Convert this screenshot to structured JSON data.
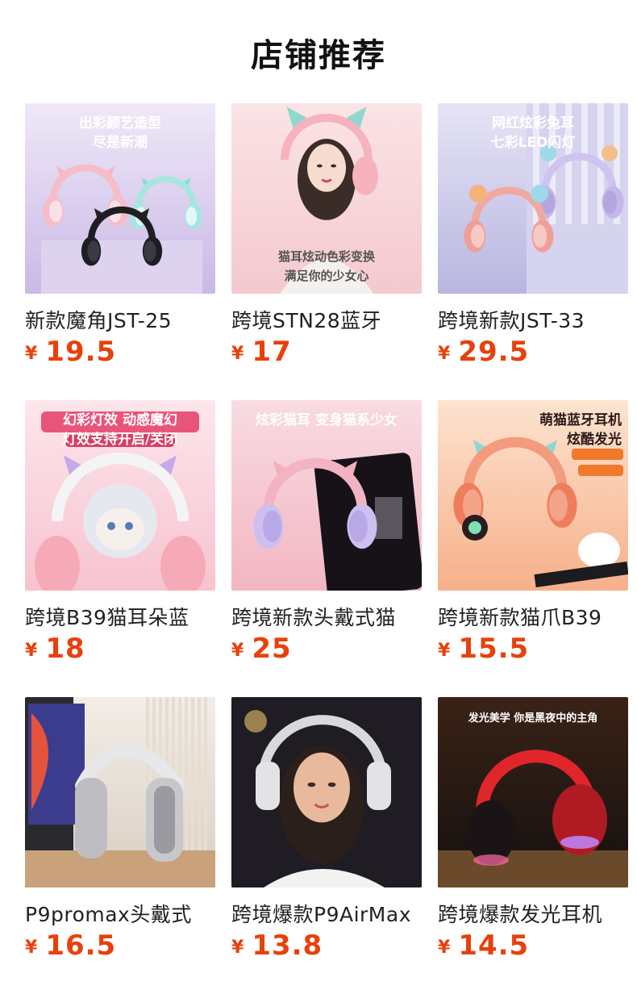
{
  "section_title": "店铺推荐",
  "currency": "¥",
  "products": [
    {
      "name": "新款魔角JST-25",
      "price": "19.5",
      "image": {
        "icon": "cat-ear-headphones-group",
        "lines": [
          "出彩颜艺造型",
          "尽是新潮"
        ],
        "bg1": "#c9b9e6",
        "bg2": "#efe8f8",
        "accent": "#f2a6b4"
      }
    },
    {
      "name": "跨境STN28蓝牙",
      "price": "17",
      "image": {
        "icon": "woman-wearing-headphones",
        "lines": [
          "猫耳炫动色彩变换",
          "满足你的少女心"
        ],
        "bg1": "#f4c9cf",
        "bg2": "#fbe3e6",
        "accent": "#f6b2bd"
      }
    },
    {
      "name": "跨境新款JST-33",
      "price": "29.5",
      "image": {
        "icon": "bear-ear-headphones",
        "lines": [
          "网红炫彩兔耳",
          "七彩LED闪灯"
        ],
        "bg1": "#b8b6e0",
        "bg2": "#e6e4f5",
        "accent": "#f0a7a0"
      }
    },
    {
      "name": "跨境B39猫耳朵蓝",
      "price": "18",
      "image": {
        "icon": "kitten-cat-ear-headphones",
        "lines": [
          "幻彩灯效 动感魔幻",
          "灯效支持开启/关闭"
        ],
        "bg1": "#f7c3cf",
        "bg2": "#fde6ec",
        "accent": "#e9557a"
      }
    },
    {
      "name": "跨境新款头戴式猫",
      "price": "25",
      "image": {
        "icon": "cat-ear-headphones-phone",
        "lines": [
          "炫彩猫耳 变身猫系少女"
        ],
        "bg1": "#f2b6c3",
        "bg2": "#f9dbe2",
        "accent": "#c8b7ea"
      }
    },
    {
      "name": "跨境新款猫爪B39",
      "price": "15.5",
      "image": {
        "icon": "paw-headphones-orange",
        "lines": [
          "萌猫蓝牙耳机",
          "炫酷发光"
        ],
        "bg1": "#f6b08a",
        "bg2": "#fde3cf",
        "accent": "#f07a55"
      }
    },
    {
      "name": "P9promax头戴式",
      "price": "16.5",
      "image": {
        "icon": "silver-over-ear-headphones",
        "lines": [],
        "bg1": "#d9cfc3",
        "bg2": "#f2ede6",
        "accent": "#c4c4c4"
      }
    },
    {
      "name": "跨境爆款P9AirMax",
      "price": "13.8",
      "image": {
        "icon": "smiling-woman-headphones",
        "lines": [],
        "bg1": "#1d1d24",
        "bg2": "#3a3640",
        "accent": "#d9d9dc"
      }
    },
    {
      "name": "跨境爆款发光耳机",
      "price": "14.5",
      "image": {
        "icon": "red-glowing-headphones",
        "lines": [
          "发光美学 你是黑夜中的主角"
        ],
        "bg1": "#141010",
        "bg2": "#3a2216",
        "accent": "#e0262b"
      }
    }
  ]
}
